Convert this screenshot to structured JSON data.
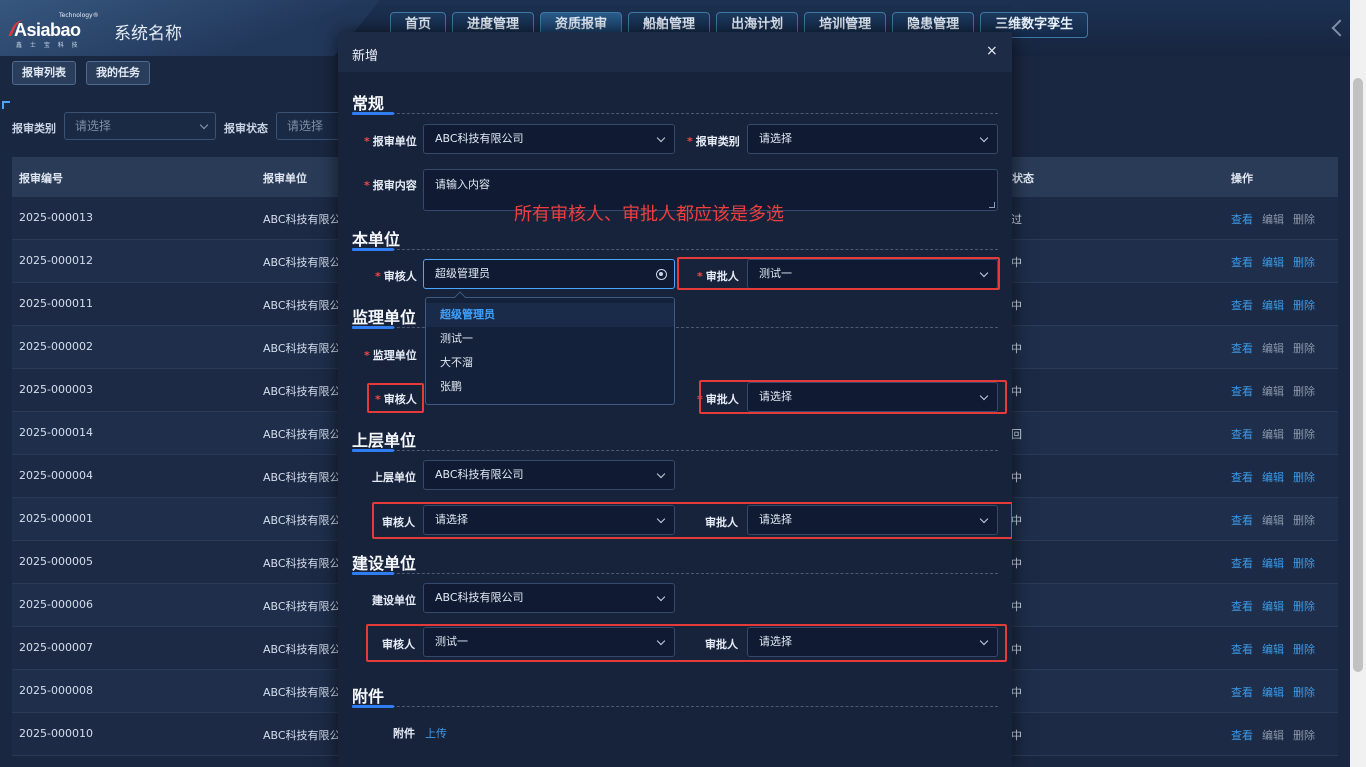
{
  "header": {
    "logo": {
      "word": "Asiabao",
      "tag": "Technology®",
      "sub": "鑫 士 宝 科 技"
    },
    "system_name": "系统名称",
    "nav": [
      "首页",
      "进度管理",
      "资质报审",
      "船舶管理",
      "出海计划",
      "培训管理",
      "隐患管理",
      "三维数字孪生"
    ]
  },
  "subtabs": [
    "报审列表",
    "我的任务"
  ],
  "filters": [
    {
      "label": "报审类别",
      "placeholder": "请选择"
    },
    {
      "label": "报审状态",
      "placeholder": "请选择"
    }
  ],
  "table": {
    "headers": {
      "code": "报审编号",
      "unit": "报审单位",
      "status": "状态",
      "actions": "操作"
    },
    "rows": [
      {
        "code": "2025-000013",
        "unit": "ABC科技有限公",
        "status": "过"
      },
      {
        "code": "2025-000012",
        "unit": "ABC科技有限公",
        "status": "中"
      },
      {
        "code": "2025-000011",
        "unit": "ABC科技有限公",
        "status": "中"
      },
      {
        "code": "2025-000002",
        "unit": "ABC科技有限公",
        "status": "中"
      },
      {
        "code": "2025-000003",
        "unit": "ABC科技有限公",
        "status": "中"
      },
      {
        "code": "2025-000014",
        "unit": "ABC科技有限公",
        "status": "回"
      },
      {
        "code": "2025-000004",
        "unit": "ABC科技有限公",
        "status": "中"
      },
      {
        "code": "2025-000001",
        "unit": "ABC科技有限公",
        "status": "中"
      },
      {
        "code": "2025-000005",
        "unit": "ABC科技有限公",
        "status": "中"
      },
      {
        "code": "2025-000006",
        "unit": "ABC科技有限公",
        "status": "中"
      },
      {
        "code": "2025-000007",
        "unit": "ABC科技有限公",
        "status": "中"
      },
      {
        "code": "2025-000008",
        "unit": "ABC科技有限公",
        "status": "中"
      },
      {
        "code": "2025-000010",
        "unit": "ABC科技有限公",
        "status": "中"
      }
    ],
    "actions": {
      "view": "查看",
      "edit": "编辑",
      "delete": "删除"
    }
  },
  "modal": {
    "title": "新增",
    "close": "×",
    "annotation": "所有审核人、审批人都应该是多选",
    "sections": {
      "general": "常规",
      "own_unit": "本单位",
      "supervision": "监理单位",
      "upper": "上层单位",
      "construction": "建设单位",
      "attachment": "附件"
    },
    "labels": {
      "unit": "报审单位",
      "category": "报审类别",
      "content": "报审内容",
      "reviewer": "审核人",
      "approver": "审批人",
      "supervision_unit": "监理单位",
      "upper_unit": "上层单位",
      "construction_unit": "建设单位",
      "attachment": "附件"
    },
    "values": {
      "unit": "ABC科技有限公司",
      "category": "请选择",
      "content_placeholder": "请输入内容",
      "own_reviewer": "超级管理员",
      "own_approver": "测试一",
      "supervision_approver": "请选择",
      "upper_unit": "ABC科技有限公司",
      "upper_reviewer": "请选择",
      "upper_approver": "请选择",
      "construction_unit": "ABC科技有限公司",
      "construction_reviewer": "测试一",
      "construction_approver": "请选择"
    },
    "dropdown_options": [
      "超级管理员",
      "测试一",
      "大不溜",
      "张鹏"
    ],
    "upload": "上传"
  },
  "colors": {
    "accent": "#3d9ae8",
    "required": "#f04848",
    "annotation": "#e53a3a"
  }
}
